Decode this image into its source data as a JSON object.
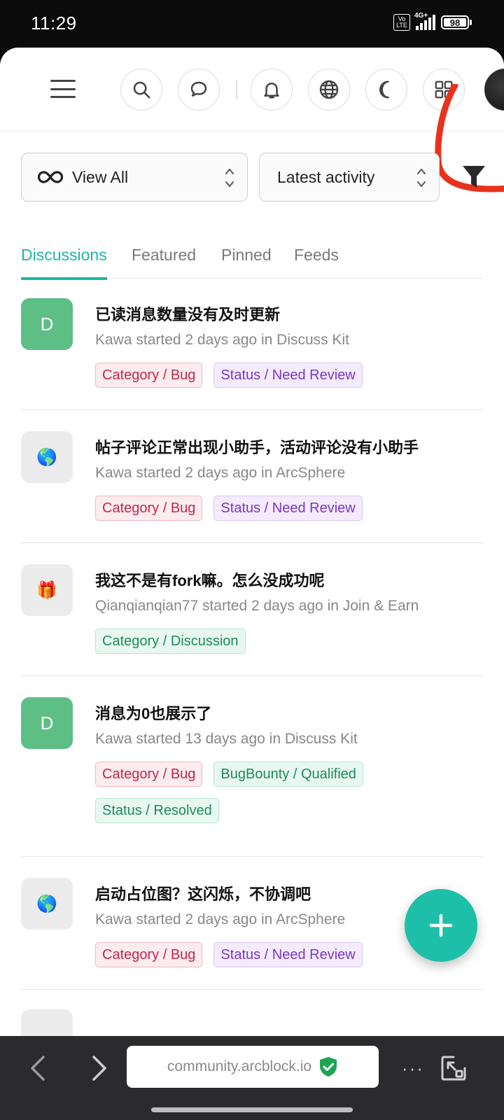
{
  "status_bar": {
    "time": "11:29",
    "volte_label": "Vo\nLTE",
    "network_label": "4G+",
    "battery_level": "98"
  },
  "header": {
    "icons": [
      "menu-icon",
      "search-icon",
      "chat-icon",
      "bell-icon",
      "globe-icon",
      "moon-icon",
      "apps-icon",
      "user-avatar"
    ]
  },
  "filters": {
    "view_label": "View All",
    "sort_label": "Latest activity"
  },
  "tabs": [
    {
      "label": "Discussions",
      "active": true
    },
    {
      "label": "Featured",
      "active": false
    },
    {
      "label": "Pinned",
      "active": false
    },
    {
      "label": "Feeds",
      "active": false
    }
  ],
  "discussions": [
    {
      "avatar": "D",
      "title": "已读消息数量没有及时更新",
      "meta": "Kawa started 2 days ago in Discuss Kit",
      "tags": [
        {
          "label": "Category / Bug",
          "kind": "bug"
        },
        {
          "label": "Status / Need Review",
          "kind": "review"
        }
      ]
    },
    {
      "avatar": "🌎",
      "title": "帖子评论正常出现小助手，活动评论没有小助手",
      "meta": "Kawa started 2 days ago in ArcSphere",
      "tags": [
        {
          "label": "Category / Bug",
          "kind": "bug"
        },
        {
          "label": "Status / Need Review",
          "kind": "review"
        }
      ]
    },
    {
      "avatar": "🎁",
      "title": "我这不是有fork嘛。怎么没成功呢",
      "meta": "Qianqianqian77 started 2 days ago in Join & Earn",
      "tags": [
        {
          "label": "Category / Discussion",
          "kind": "green"
        }
      ]
    },
    {
      "avatar": "D",
      "title": "消息为0也展示了",
      "meta": "Kawa started 13 days ago in Discuss Kit",
      "tags": [
        {
          "label": "Category / Bug",
          "kind": "bug"
        },
        {
          "label": "BugBounty / Qualified",
          "kind": "green"
        },
        {
          "label": "Status / Resolved",
          "kind": "green"
        }
      ]
    },
    {
      "avatar": "🌎",
      "title": "启动占位图？这闪烁，不协调吧",
      "meta": "Kawa started 2 days ago in ArcSphere",
      "tags": [
        {
          "label": "Category / Bug",
          "kind": "bug"
        },
        {
          "label": "Status / Need Review",
          "kind": "review"
        }
      ]
    }
  ],
  "fab": {
    "label": "+"
  },
  "browser": {
    "url": "community.arcblock.io",
    "more_label": "···"
  },
  "colors": {
    "accent": "#1fb7a4",
    "annotation": "#e8321e"
  }
}
